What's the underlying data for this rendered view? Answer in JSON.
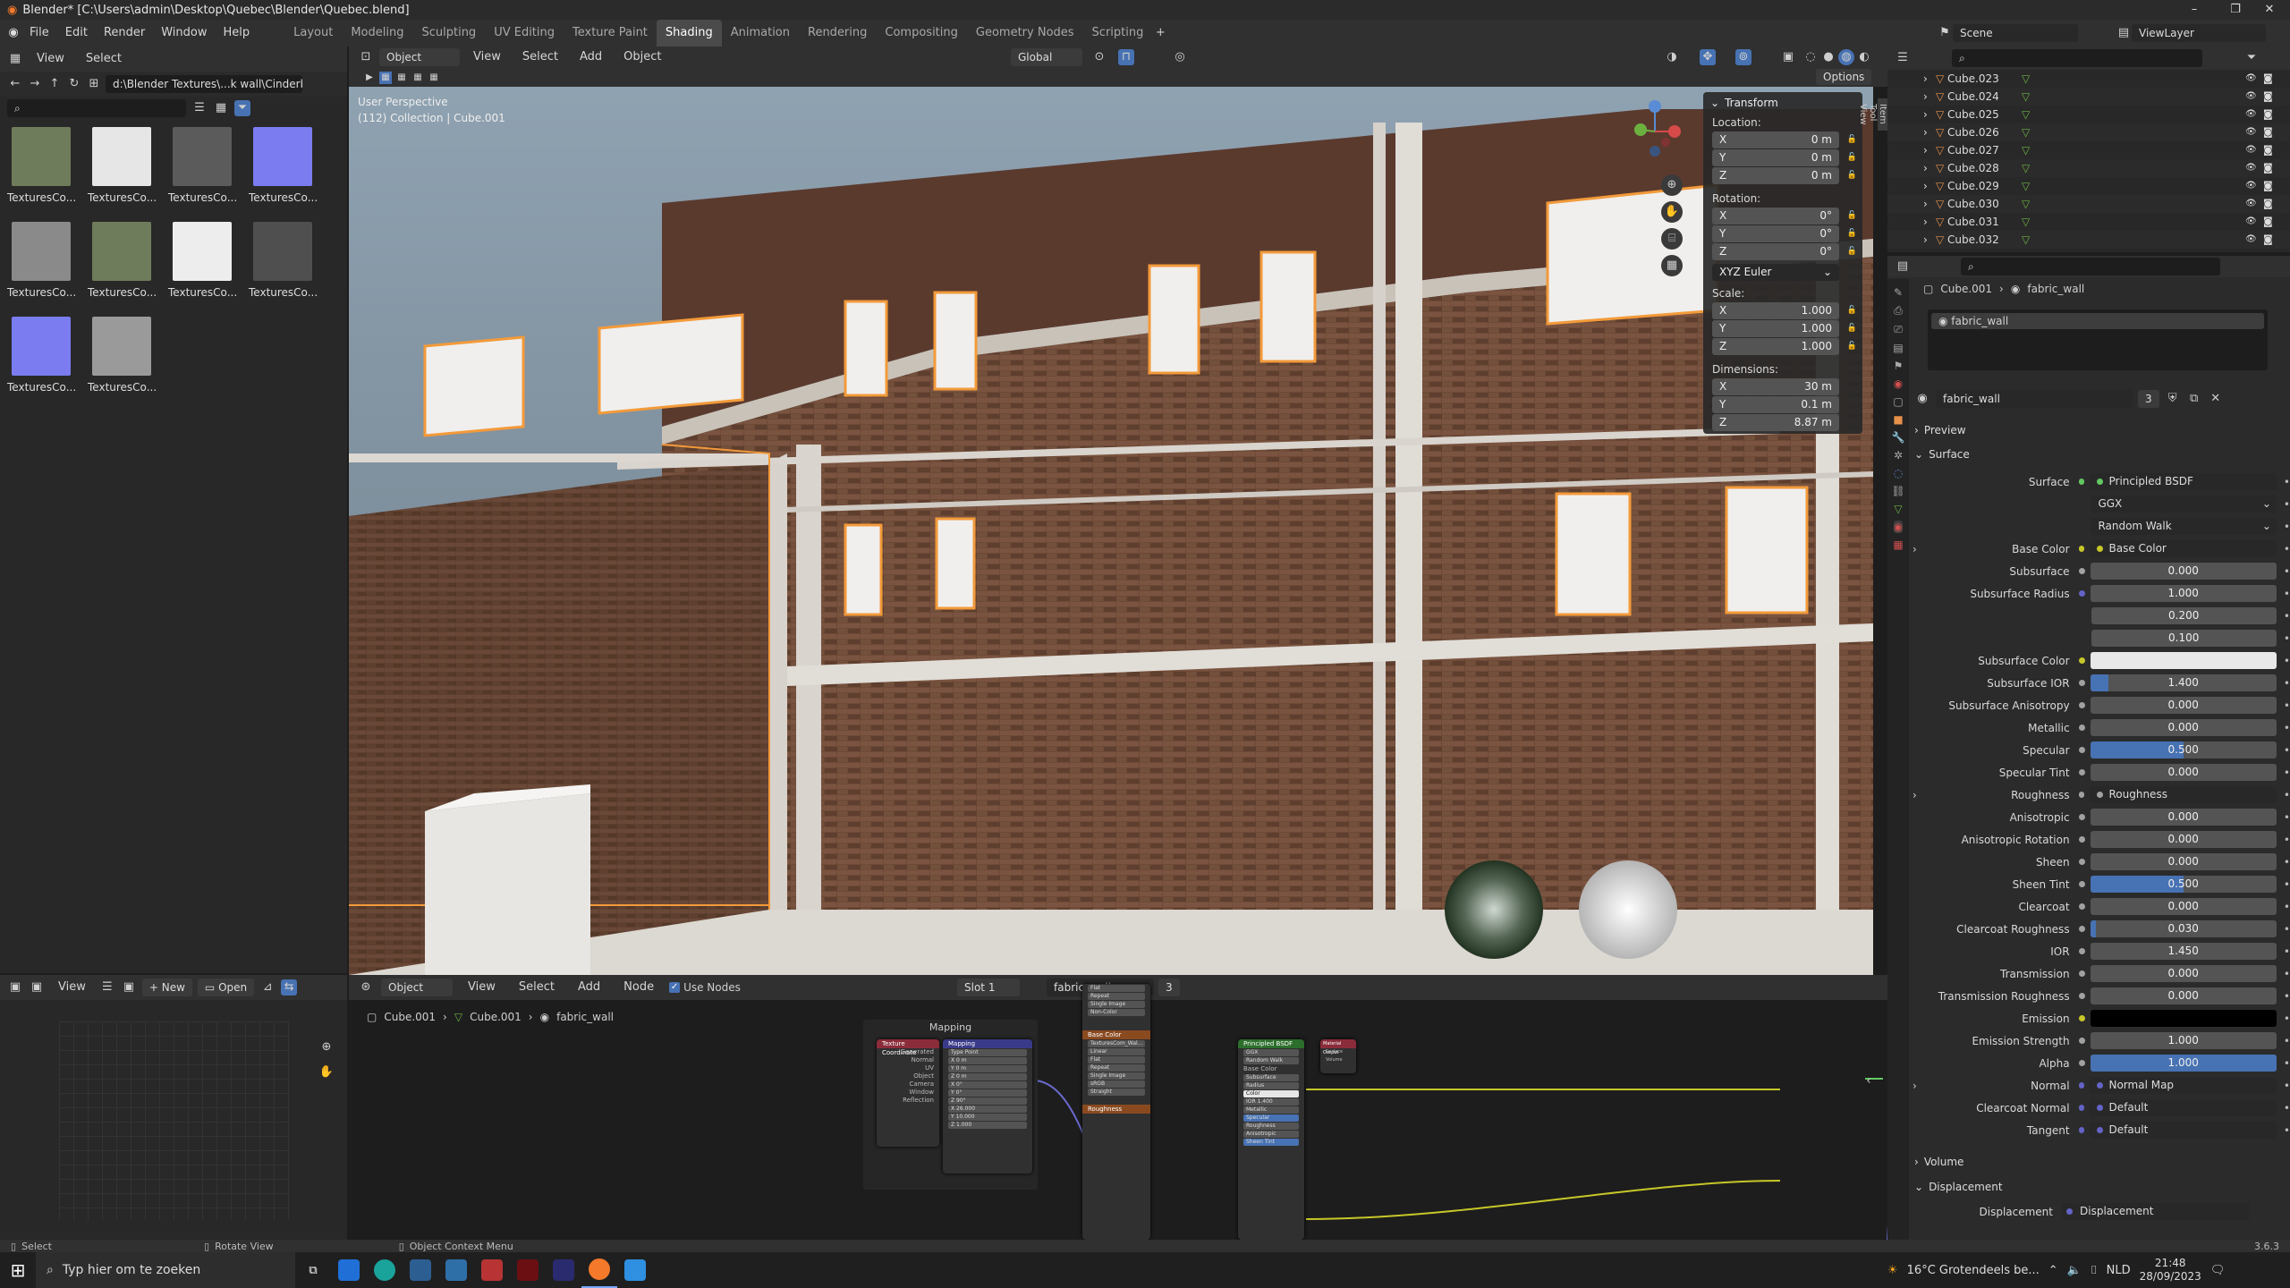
{
  "titlebar": {
    "title": "Blender* [C:\\Users\\admin\\Desktop\\Quebec\\Blender\\Quebec.blend]"
  },
  "menu": {
    "items": [
      "File",
      "Edit",
      "Render",
      "Window",
      "Help"
    ],
    "workspaces": [
      "Layout",
      "Modeling",
      "Sculpting",
      "UV Editing",
      "Texture Paint",
      "Shading",
      "Animation",
      "Rendering",
      "Compositing",
      "Geometry Nodes",
      "Scripting"
    ],
    "active_workspace": "Shading",
    "scene": "Scene",
    "view_layer": "ViewLayer"
  },
  "filebrowser": {
    "menu": [
      "View",
      "Select"
    ],
    "path": "d:\\Blender Textures\\...k wall\\Cinderblocks\\",
    "thumbs": [
      {
        "label": "TexturesCo...",
        "color": "#6f7c5c"
      },
      {
        "label": "TexturesCo...",
        "color": "#e6e6e6"
      },
      {
        "label": "TexturesCo...",
        "color": "#5b5b5b"
      },
      {
        "label": "TexturesCo...",
        "color": "#7a7cf0"
      },
      {
        "label": "TexturesCo...",
        "color": "#8a8a8a"
      },
      {
        "label": "TexturesCo...",
        "color": "#6f7c5c"
      },
      {
        "label": "TexturesCo...",
        "color": "#ededed"
      },
      {
        "label": "TexturesCo...",
        "color": "#4f4f4f"
      },
      {
        "label": "TexturesCo...",
        "color": "#7a7cf0"
      },
      {
        "label": "TexturesCo...",
        "color": "#9a9a9a"
      }
    ]
  },
  "viewport_header": {
    "mode": "Object Mode",
    "menu": [
      "View",
      "Select",
      "Add",
      "Object"
    ],
    "orientation": "Global",
    "options": "Options"
  },
  "viewport": {
    "perspective": "User Perspective",
    "collection": "(112) Collection | Cube.001"
  },
  "npanel": {
    "title": "Transform",
    "tabs": [
      "Item",
      "Tool",
      "View"
    ],
    "location_label": "Location:",
    "rotation_label": "Rotation:",
    "scale_label": "Scale:",
    "dimensions_label": "Dimensions:",
    "location": [
      {
        "axis": "X",
        "value": "0 m"
      },
      {
        "axis": "Y",
        "value": "0 m"
      },
      {
        "axis": "Z",
        "value": "0 m"
      }
    ],
    "rotation": [
      {
        "axis": "X",
        "value": "0°"
      },
      {
        "axis": "Y",
        "value": "0°"
      },
      {
        "axis": "Z",
        "value": "0°"
      }
    ],
    "rotation_mode": "XYZ Euler",
    "scale": [
      {
        "axis": "X",
        "value": "1.000"
      },
      {
        "axis": "Y",
        "value": "1.000"
      },
      {
        "axis": "Z",
        "value": "1.000"
      }
    ],
    "dimensions": [
      {
        "axis": "X",
        "value": "30 m"
      },
      {
        "axis": "Y",
        "value": "0.1 m"
      },
      {
        "axis": "Z",
        "value": "8.87 m"
      }
    ]
  },
  "outliner": {
    "items": [
      "Cube.023",
      "Cube.024",
      "Cube.025",
      "Cube.026",
      "Cube.027",
      "Cube.028",
      "Cube.029",
      "Cube.030",
      "Cube.031",
      "Cube.032"
    ]
  },
  "properties": {
    "breadcrumb_object": "Cube.001",
    "breadcrumb_material": "fabric_wall",
    "slot_material": "fabric_wall",
    "material_name": "fabric_wall",
    "users": "3",
    "preview_label": "Preview",
    "surface_label": "Surface",
    "volume_label": "Volume",
    "displacement_label": "Displacement",
    "rows": [
      {
        "label": "Surface",
        "kind": "link",
        "value": "Principled BSDF",
        "sock": "#63c763"
      },
      {
        "label": "",
        "kind": "dropdown",
        "value": "GGX"
      },
      {
        "label": "",
        "kind": "dropdown",
        "value": "Random Walk"
      },
      {
        "label": "Base Color",
        "kind": "link",
        "value": "Base Color",
        "sock": "#c7c729",
        "expand": true
      },
      {
        "label": "Subsurface",
        "kind": "num",
        "value": "0.000",
        "fill": 0,
        "sock": "#a1a1a1"
      },
      {
        "label": "Subsurface Radius",
        "kind": "num",
        "value": "1.000",
        "fill": 0,
        "sock": "#6363c7"
      },
      {
        "label": "",
        "kind": "num",
        "value": "0.200",
        "fill": 0
      },
      {
        "label": "",
        "kind": "num",
        "value": "0.100",
        "fill": 0
      },
      {
        "label": "Subsurface Color",
        "kind": "color",
        "value": "",
        "color": "#e8e8e8",
        "sock": "#c7c729"
      },
      {
        "label": "Subsurface IOR",
        "kind": "num",
        "value": "1.400",
        "fill": 0.1,
        "sock": "#a1a1a1"
      },
      {
        "label": "Subsurface Anisotropy",
        "kind": "num",
        "value": "0.000",
        "fill": 0,
        "sock": "#a1a1a1"
      },
      {
        "label": "Metallic",
        "kind": "num",
        "value": "0.000",
        "fill": 0,
        "sock": "#a1a1a1"
      },
      {
        "label": "Specular",
        "kind": "num",
        "value": "0.500",
        "fill": 0.5,
        "sock": "#a1a1a1"
      },
      {
        "label": "Specular Tint",
        "kind": "num",
        "value": "0.000",
        "fill": 0,
        "sock": "#a1a1a1"
      },
      {
        "label": "Roughness",
        "kind": "link",
        "value": "Roughness",
        "sock": "#a1a1a1",
        "expand": true
      },
      {
        "label": "Anisotropic",
        "kind": "num",
        "value": "0.000",
        "fill": 0,
        "sock": "#a1a1a1"
      },
      {
        "label": "Anisotropic Rotation",
        "kind": "num",
        "value": "0.000",
        "fill": 0,
        "sock": "#a1a1a1"
      },
      {
        "label": "Sheen",
        "kind": "num",
        "value": "0.000",
        "fill": 0,
        "sock": "#a1a1a1"
      },
      {
        "label": "Sheen Tint",
        "kind": "num",
        "value": "0.500",
        "fill": 0.5,
        "sock": "#a1a1a1"
      },
      {
        "label": "Clearcoat",
        "kind": "num",
        "value": "0.000",
        "fill": 0,
        "sock": "#a1a1a1"
      },
      {
        "label": "Clearcoat Roughness",
        "kind": "num",
        "value": "0.030",
        "fill": 0.03,
        "sock": "#a1a1a1"
      },
      {
        "label": "IOR",
        "kind": "num",
        "value": "1.450",
        "fill": 0,
        "sock": "#a1a1a1"
      },
      {
        "label": "Transmission",
        "kind": "num",
        "value": "0.000",
        "fill": 0,
        "sock": "#a1a1a1"
      },
      {
        "label": "Transmission Roughness",
        "kind": "num",
        "value": "0.000",
        "fill": 0,
        "sock": "#a1a1a1"
      },
      {
        "label": "Emission",
        "kind": "color",
        "value": "",
        "color": "#000000",
        "sock": "#c7c729"
      },
      {
        "label": "Emission Strength",
        "kind": "num",
        "value": "1.000",
        "fill": 0,
        "sock": "#a1a1a1"
      },
      {
        "label": "Alpha",
        "kind": "num",
        "value": "1.000",
        "fill": 1,
        "sock": "#a1a1a1"
      },
      {
        "label": "Normal",
        "kind": "link",
        "value": "Normal Map",
        "sock": "#6363c7",
        "expand": true
      },
      {
        "label": "Clearcoat Normal",
        "kind": "link",
        "value": "Default",
        "sock": "#6363c7"
      },
      {
        "label": "Tangent",
        "kind": "link",
        "value": "Default",
        "sock": "#6363c7"
      }
    ],
    "displacement_row": {
      "label": "Displacement",
      "value": "Displacement"
    }
  },
  "node_editor": {
    "menu": [
      "View",
      "Select",
      "Add",
      "Node"
    ],
    "use_nodes": "Use Nodes",
    "mode": "Object",
    "slot": "Slot 1",
    "material": "fabric_wall",
    "users": "3",
    "breadcrumb": [
      "Cube.001",
      "Cube.001",
      "fabric_wall"
    ],
    "frame_label": "Mapping",
    "nodes": {
      "texcoord": "Texture Coordinate",
      "mapping": "Mapping",
      "bsdf": "Principled BSDF",
      "output": "Material Output",
      "base_color": "Base Color",
      "roughness": "Roughness",
      "texture": "TexturesCom_Wal..."
    }
  },
  "image_editor": {
    "menu": [
      "View"
    ],
    "new_label": "New",
    "open_label": "Open"
  },
  "statusbar": {
    "left": "Select",
    "mid": "Rotate View",
    "context": "Object Context Menu",
    "version": "3.6.3"
  },
  "taskbar": {
    "search": "Typ hier om te zoeken",
    "weather": "16°C  Grotendeels be...",
    "lang": "NLD",
    "time": "21:48",
    "date": "28/09/2023"
  }
}
